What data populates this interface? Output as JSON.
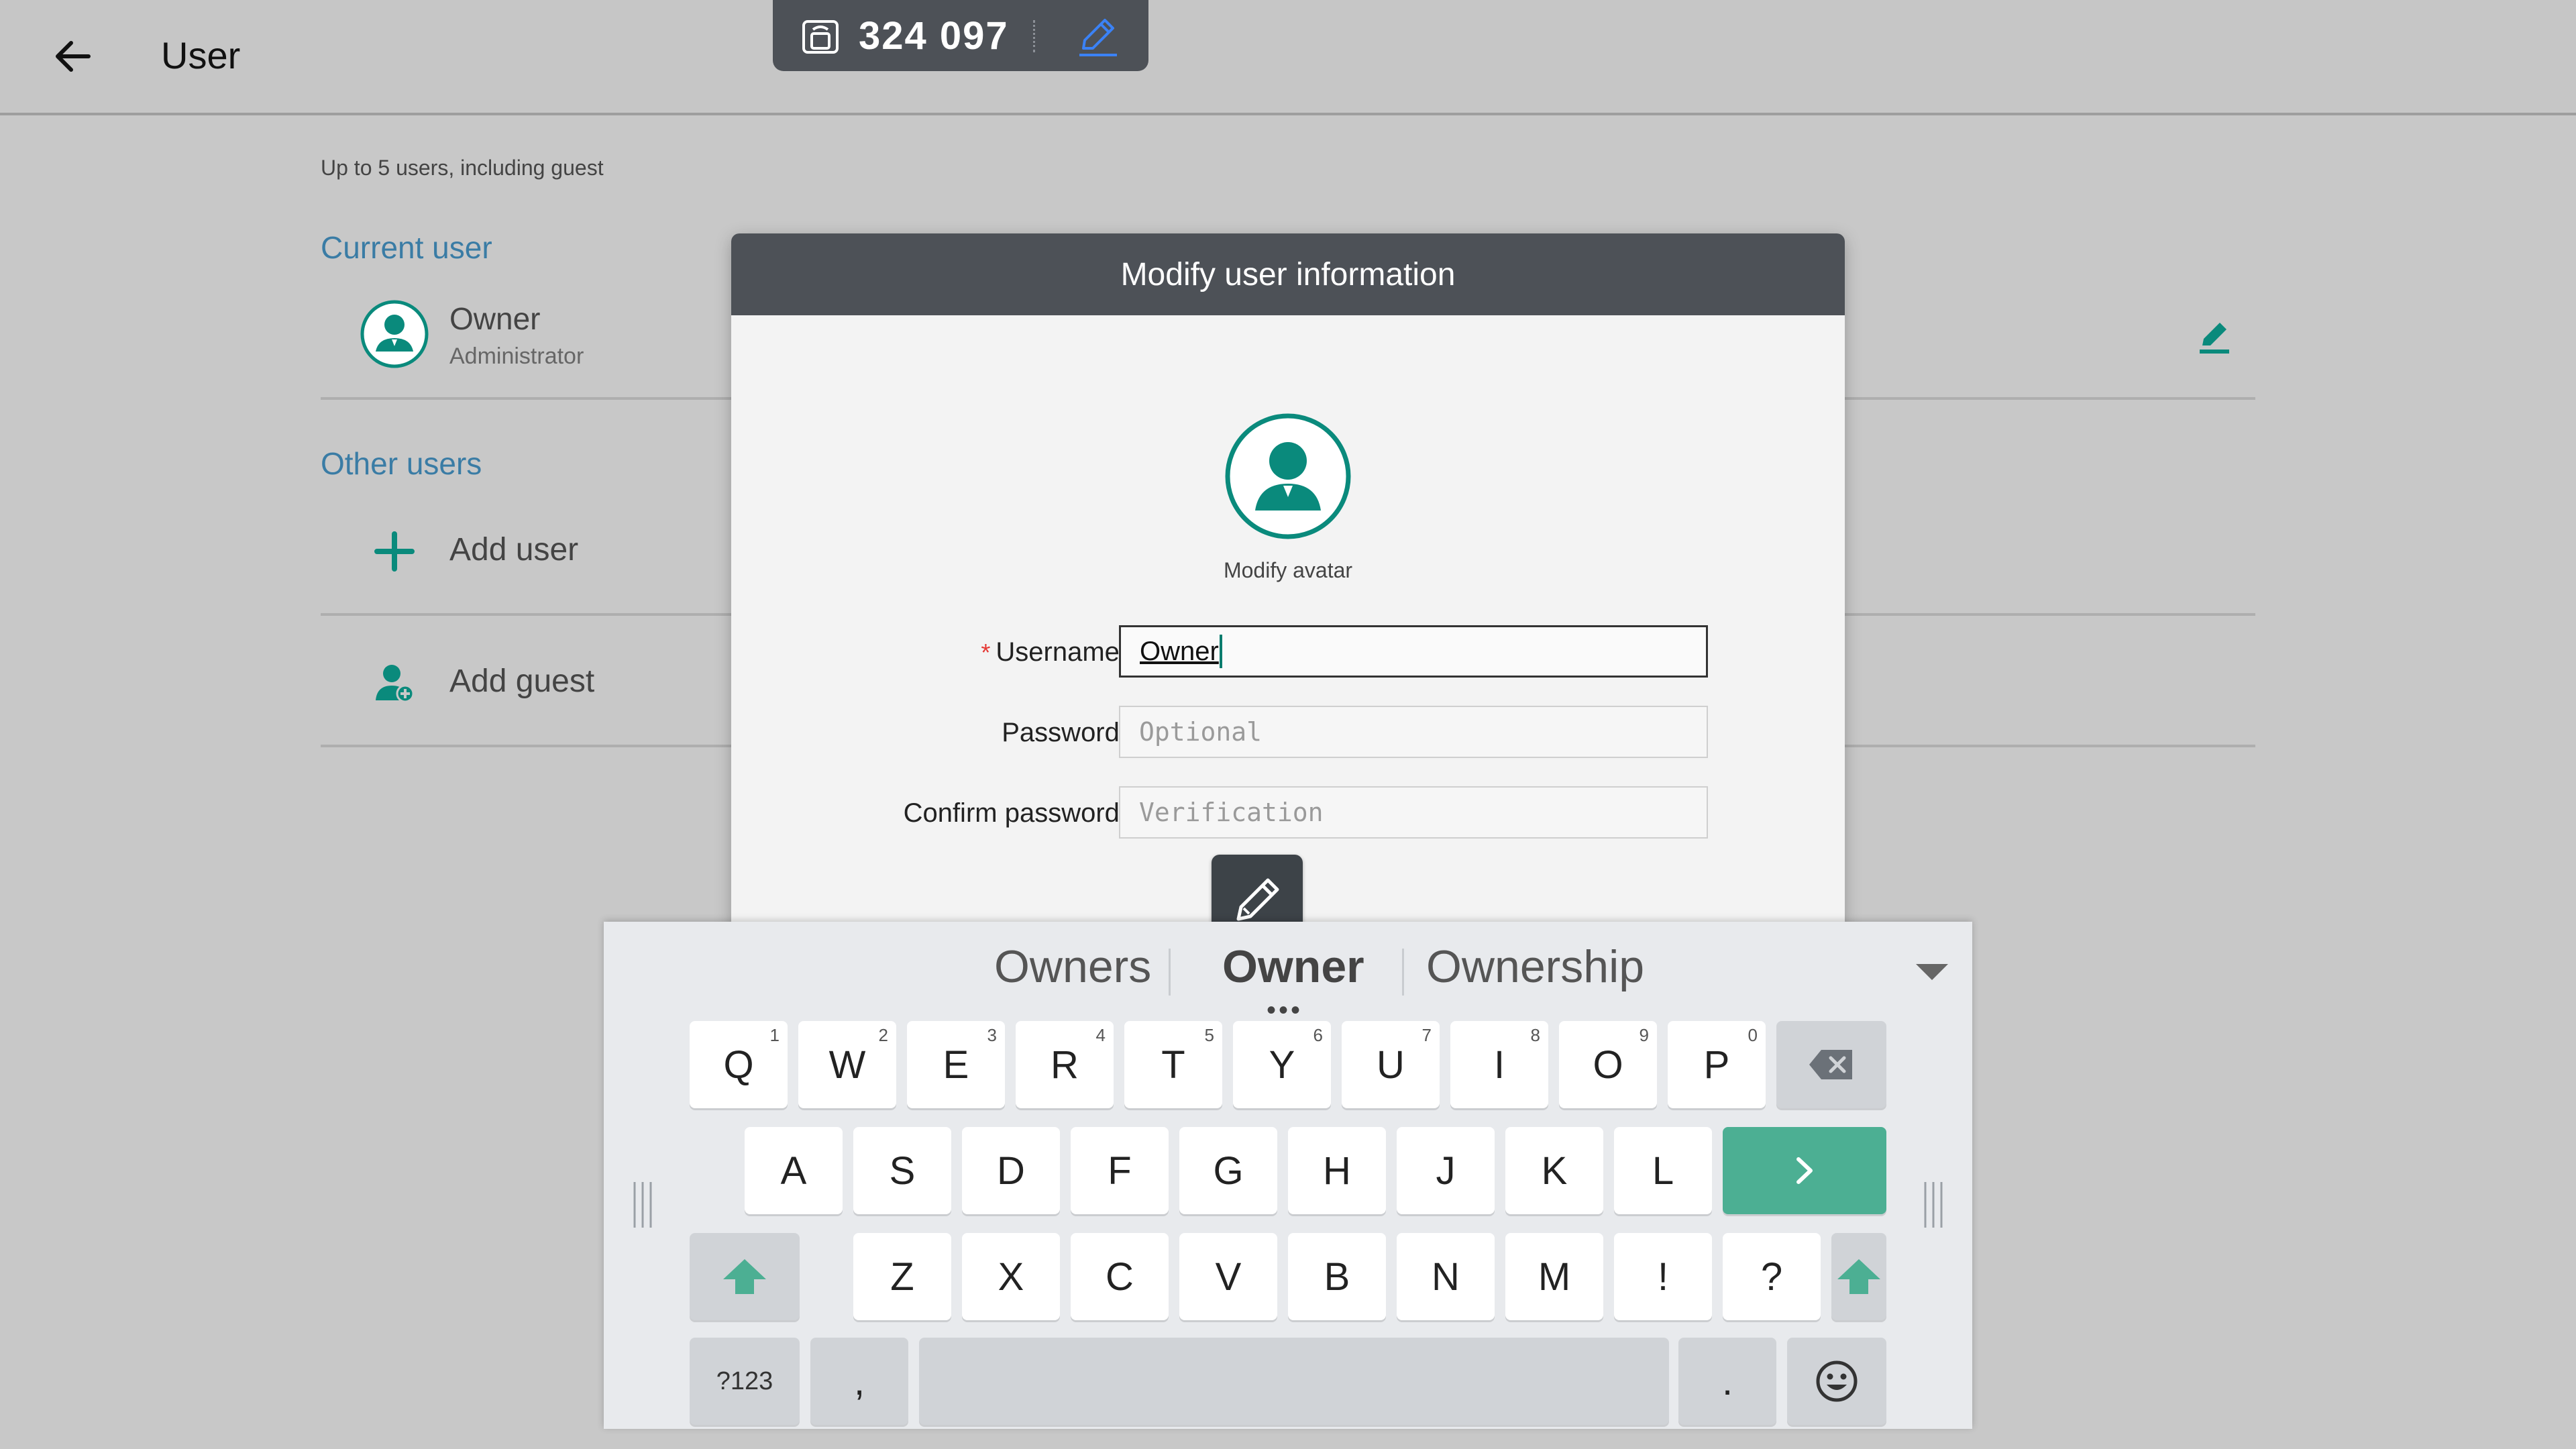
{
  "header": {
    "title": "User"
  },
  "cast": {
    "code": "324 097"
  },
  "settings": {
    "hint": "Up to 5 users, including guest",
    "current_section": "Current user",
    "owner_name": "Owner",
    "owner_role": "Administrator",
    "other_section": "Other users",
    "add_user": "Add user",
    "add_guest": "Add guest"
  },
  "dialog": {
    "title": "Modify user information",
    "avatar_caption": "Modify avatar",
    "username_label": "Username:",
    "username_required": "*",
    "username_value": "Owner",
    "password_label": "Password:",
    "password_placeholder": "Optional",
    "confirm_label": "Confirm password:",
    "confirm_placeholder": "Verification"
  },
  "keyboard": {
    "suggestions": [
      "Owners",
      "Owner",
      "Ownership"
    ],
    "more_indicator": "•••",
    "rows": [
      [
        {
          "k": "Q",
          "n": "1"
        },
        {
          "k": "W",
          "n": "2"
        },
        {
          "k": "E",
          "n": "3"
        },
        {
          "k": "R",
          "n": "4"
        },
        {
          "k": "T",
          "n": "5"
        },
        {
          "k": "Y",
          "n": "6"
        },
        {
          "k": "U",
          "n": "7"
        },
        {
          "k": "I",
          "n": "8"
        },
        {
          "k": "O",
          "n": "9"
        },
        {
          "k": "P",
          "n": "0"
        }
      ],
      [
        {
          "k": "A"
        },
        {
          "k": "S"
        },
        {
          "k": "D"
        },
        {
          "k": "F"
        },
        {
          "k": "G"
        },
        {
          "k": "H"
        },
        {
          "k": "J"
        },
        {
          "k": "K"
        },
        {
          "k": "L"
        }
      ],
      [
        {
          "k": "Z"
        },
        {
          "k": "X"
        },
        {
          "k": "C"
        },
        {
          "k": "V"
        },
        {
          "k": "B"
        },
        {
          "k": "N"
        },
        {
          "k": "M"
        },
        {
          "k": "!"
        },
        {
          "k": "?"
        }
      ]
    ],
    "symbols_label": "?123",
    "comma": ",",
    "period": "."
  },
  "icons": {
    "back": "arrow-left-icon",
    "cast": "screen-share-icon",
    "edit": "pencil-icon",
    "avatar": "user-avatar-icon",
    "add": "plus-icon",
    "guest": "person-add-icon",
    "backspace": "backspace-icon",
    "enter": "chevron-right-icon",
    "shift": "shift-arrow-icon",
    "emoji": "emoji-icon",
    "collapse": "caret-down-icon"
  },
  "colors": {
    "accent": "#0a8a7c",
    "link": "#3a7ca5",
    "dialog_header": "#4d5157",
    "enter_key": "#4caf93",
    "required": "#e53935"
  }
}
